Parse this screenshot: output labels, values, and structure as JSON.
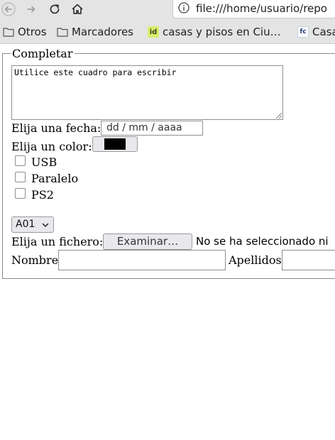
{
  "browser": {
    "url": "file:///home/usuario/repo",
    "bookmarks": [
      {
        "label": "Otros",
        "icon": "folder-icon"
      },
      {
        "label": "Marcadores",
        "icon": "folder-icon"
      },
      {
        "label": "casas y pisos en Ciu…",
        "icon": "favicon-id",
        "favicon_text": "id"
      },
      {
        "label": "Casa",
        "icon": "favicon-fc",
        "favicon_text": "fc"
      }
    ]
  },
  "form": {
    "legend": "Completar",
    "textarea_value": "Utilice este cuadro para escribir",
    "date_label": "Elija una fecha:",
    "date_placeholder": "dd / mm / aaaa",
    "color_label": "Elija un color:",
    "color_value": "#000000",
    "checkboxes": [
      {
        "label": "USB",
        "checked": false
      },
      {
        "label": "Paralelo",
        "checked": false
      },
      {
        "label": "PS2",
        "checked": false
      }
    ],
    "select_value": "A01",
    "file_label": "Elija un fichero:",
    "file_button": "Examinar…",
    "file_status": "No se ha seleccionado ni",
    "nombre_label": "Nombre",
    "apellidos_label": "Apellidos"
  }
}
